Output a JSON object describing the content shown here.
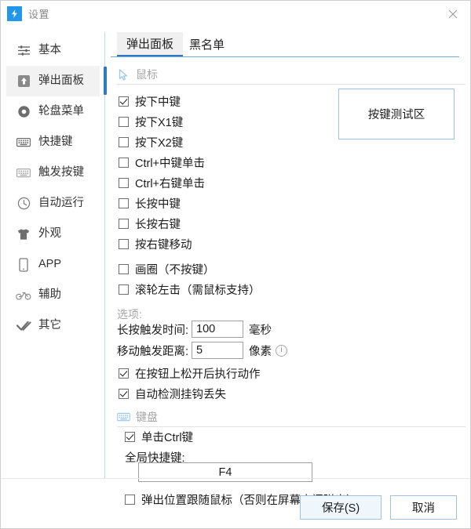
{
  "window": {
    "title": "设置",
    "app_icon": "lightning-bolt-icon",
    "close_icon": "close-icon"
  },
  "sidebar": {
    "items": [
      {
        "label": "基本",
        "icon": "sliders-icon",
        "active": false
      },
      {
        "label": "弹出面板",
        "icon": "arrow-up-box-icon",
        "active": true
      },
      {
        "label": "轮盘菜单",
        "icon": "circle-dot-icon",
        "active": false
      },
      {
        "label": "快捷键",
        "icon": "keyboard-icon",
        "active": false
      },
      {
        "label": "触发按键",
        "icon": "keyboard-light-icon",
        "active": false
      },
      {
        "label": "自动运行",
        "icon": "clock-icon",
        "active": false
      },
      {
        "label": "外观",
        "icon": "tshirt-icon",
        "active": false
      },
      {
        "label": "APP",
        "icon": "phone-icon",
        "active": false
      },
      {
        "label": "辅助",
        "icon": "bicycle-icon",
        "active": false
      },
      {
        "label": "其它",
        "icon": "double-check-icon",
        "active": false
      }
    ]
  },
  "tabs": [
    {
      "label": "弹出面板",
      "active": true
    },
    {
      "label": "黑名单",
      "active": false
    }
  ],
  "mouse_section": {
    "title": "鼠标",
    "icon": "cursor-arrow-icon",
    "checkboxes": [
      {
        "label": "按下中键",
        "checked": true
      },
      {
        "label": "按下X1键",
        "checked": false
      },
      {
        "label": "按下X2键",
        "checked": false
      },
      {
        "label": "Ctrl+中键单击",
        "checked": false
      },
      {
        "label": "Ctrl+右键单击",
        "checked": false
      },
      {
        "label": "长按中键",
        "checked": false
      },
      {
        "label": "长按右键",
        "checked": false
      },
      {
        "label": "按右键移动",
        "checked": false
      },
      {
        "label": "画圈（不按键）",
        "checked": false
      },
      {
        "label": "滚轮左击（需鼠标支持）",
        "checked": false
      }
    ],
    "options_label": "选项:",
    "numeric_fields": [
      {
        "label": "长按触发时间:",
        "value": "100",
        "unit": "毫秒",
        "info": false
      },
      {
        "label": "移动触发距离:",
        "value": "5",
        "unit": "像素",
        "info": true,
        "info_icon": "info-icon"
      }
    ],
    "option_checkboxes": [
      {
        "label": "在按钮上松开后执行动作",
        "checked": true
      },
      {
        "label": "自动检测挂钩丢失",
        "checked": true
      }
    ]
  },
  "keyboard_section": {
    "title": "键盘",
    "icon": "keyboard-icon",
    "click_ctrl": {
      "label": "单击Ctrl键",
      "checked": true
    },
    "hotkey_label": "全局快捷键:",
    "hotkey_value": "F4",
    "follow_mouse": {
      "label": "弹出位置跟随鼠标（否则在屏幕中间弹出）",
      "checked": false
    }
  },
  "test_area": {
    "label": "按键测试区"
  },
  "footer": {
    "save_label": "保存(S)",
    "cancel_label": "取消"
  },
  "colors": {
    "accent": "#2f79c4",
    "app_icon_bg": "#2296e8",
    "divider": "#bcd9f2",
    "button_border": "#9dc3e6",
    "primary_button_bg": "#eff6fc"
  }
}
